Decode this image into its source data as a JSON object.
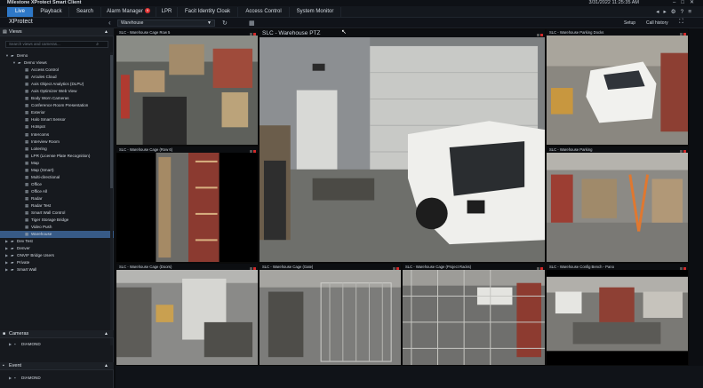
{
  "title_bar": {
    "app_title": "Milestone XProtect Smart Client",
    "datetime": "3/31/2022 11:25:35 AM"
  },
  "tabs": [
    {
      "label": "Live",
      "active": true
    },
    {
      "label": "Playback"
    },
    {
      "label": "Search"
    },
    {
      "label": "Alarm Manager",
      "badge": "9"
    },
    {
      "label": "LPR"
    },
    {
      "label": "Facit Identity Cloak"
    },
    {
      "label": "Access Control"
    },
    {
      "label": "System Monitor"
    }
  ],
  "toolbar": {
    "product": "XProtect",
    "current_view": "Warehouse",
    "setup_label": "Setup",
    "call_history_label": "Call history"
  },
  "sidebar": {
    "views_label": "Views",
    "search_placeholder": "Search views and cameras...",
    "tree": [
      {
        "label": "Demo",
        "level": 0,
        "expanded": true
      },
      {
        "label": "Demo Views",
        "level": 1,
        "expanded": true
      },
      {
        "label": "Access Control",
        "level": 2
      },
      {
        "label": "Arcules Cloud",
        "level": 2
      },
      {
        "label": "Axis Object Analytics (DLPU)",
        "level": 2
      },
      {
        "label": "Axis Optimizer Web View",
        "level": 2
      },
      {
        "label": "Body Worn Cameras",
        "level": 2
      },
      {
        "label": "Conference Room Presentation",
        "level": 2
      },
      {
        "label": "Exterior",
        "level": 2
      },
      {
        "label": "Halo Smart Sensor",
        "level": 2
      },
      {
        "label": "Hotspot",
        "level": 2
      },
      {
        "label": "Intercoms",
        "level": 2
      },
      {
        "label": "Interview Room",
        "level": 2
      },
      {
        "label": "Loitering",
        "level": 2
      },
      {
        "label": "LPR (License Plate Recognition)",
        "level": 2
      },
      {
        "label": "Map",
        "level": 2
      },
      {
        "label": "Map (Smart)",
        "level": 2
      },
      {
        "label": "Multi-directional",
        "level": 2
      },
      {
        "label": "Office",
        "level": 2
      },
      {
        "label": "Office All",
        "level": 2
      },
      {
        "label": "Radar",
        "level": 2
      },
      {
        "label": "Radar Test",
        "level": 2
      },
      {
        "label": "Smart Wall Control",
        "level": 2
      },
      {
        "label": "Tiger Storage Bridge",
        "level": 2
      },
      {
        "label": "Video Push",
        "level": 2
      },
      {
        "label": "Warehouse",
        "level": 2,
        "selected": true
      },
      {
        "label": "Dev Test",
        "level": 0
      },
      {
        "label": "Denver",
        "level": 0
      },
      {
        "label": "ONVIF Bridge Users",
        "level": 0
      },
      {
        "label": "Private",
        "level": 0
      },
      {
        "label": "Smart Wall",
        "level": 0
      }
    ],
    "cameras_label": "Cameras",
    "cameras_item": "DIAMOND",
    "event_label": "Event",
    "event_item": "DIAMOND"
  },
  "tiles": [
    {
      "title": "SLC - Warehouse Cage Row 5"
    },
    {
      "title": "SLC - Warehouse PTZ"
    },
    {
      "title": "SLC - Warehouse Parking Docks"
    },
    {
      "title": "SLC - Warehouse Cage (Row 6)"
    },
    {
      "title": "SLC - Warehouse Parking"
    },
    {
      "title": "SLC - Warehouse Cage (Doors)"
    },
    {
      "title": "SLC - Warehouse Cage (Gate)"
    },
    {
      "title": "SLC - Warehouse Cage (Project Racks)"
    },
    {
      "title": "SLC - Warehouse Config Bench - Pano"
    }
  ],
  "colors": {
    "accent": "#2e78c8",
    "selected_row": "#375a86",
    "status_red": "#d12a2a"
  }
}
